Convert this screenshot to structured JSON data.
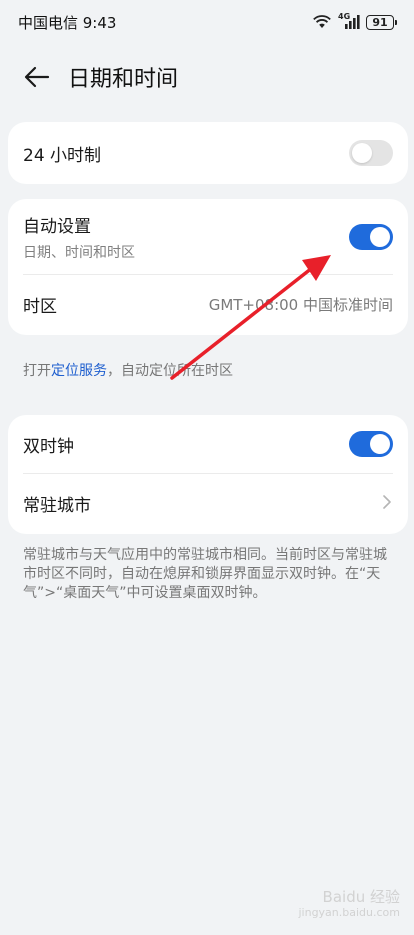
{
  "status_bar": {
    "carrier_time": "中国电信 9:43",
    "network": "4G",
    "battery": "91",
    "icons": [
      "wifi-icon",
      "signal-icon",
      "battery-icon"
    ]
  },
  "header": {
    "back_icon": "arrow-left-icon",
    "title": "日期和时间"
  },
  "card_24h": {
    "label": "24 小时制",
    "toggle_state": "off"
  },
  "card_auto": {
    "auto_label": "自动设置",
    "auto_sub": "日期、时间和时区",
    "auto_toggle_state": "on",
    "timezone_label": "时区",
    "timezone_value": "GMT+08:00 中国标准时间"
  },
  "location_hint": {
    "prefix": "打开",
    "link": "定位服务",
    "suffix": "，自动定位所在时区"
  },
  "card_dual": {
    "dual_label": "双时钟",
    "dual_toggle_state": "on",
    "city_label": "常驻城市",
    "city_chevron": "chevron-right-icon"
  },
  "dual_hint": "常驻城市与天气应用中的常驻城市相同。当前时区与常驻城市时区不同时，自动在熄屏和锁屏界面显示双时钟。在“天气”>“桌面天气”中可设置桌面双时钟。",
  "watermark": {
    "main": "Baidu 经验",
    "sub": "jingyan.baidu.com"
  },
  "colors": {
    "accent": "#1f6bdc",
    "annotation_arrow": "#e8202a",
    "background": "#f1f3f5"
  }
}
